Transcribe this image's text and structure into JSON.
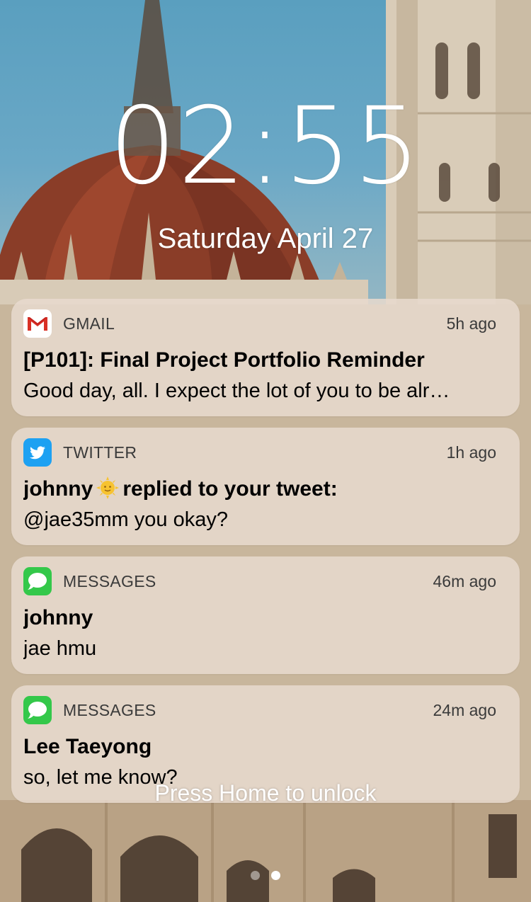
{
  "lockscreen": {
    "time_hours": "02",
    "time_separator": ":",
    "time_minutes": "55",
    "date": "Saturday April 27",
    "unlock_hint": "Press Home to unlock",
    "page_count": 2,
    "active_page": 2
  },
  "notifications": [
    {
      "app": "GMAIL",
      "icon": "gmail-icon",
      "time": "5h ago",
      "title": "[P101]: Final Project Portfolio Reminder",
      "body": "Good day, all. I expect the lot of you to be alr…"
    },
    {
      "app": "TWITTER",
      "icon": "twitter-bird-icon",
      "time": "1h ago",
      "title_user": "johnny",
      "title_emoji": "sun-with-face-emoji",
      "title_rest": "replied to your tweet:",
      "body": "@jae35mm you okay?"
    },
    {
      "app": "MESSAGES",
      "icon": "messages-bubble-icon",
      "time": "46m ago",
      "title": "johnny",
      "body": "jae hmu"
    },
    {
      "app": "MESSAGES",
      "icon": "messages-bubble-icon",
      "time": "24m ago",
      "title": "Lee Taeyong",
      "body": "so, let me know?"
    }
  ],
  "colors": {
    "twitter_blue": "#1da1f2",
    "messages_green": "#34c84a",
    "gmail_red": "#d93025"
  }
}
